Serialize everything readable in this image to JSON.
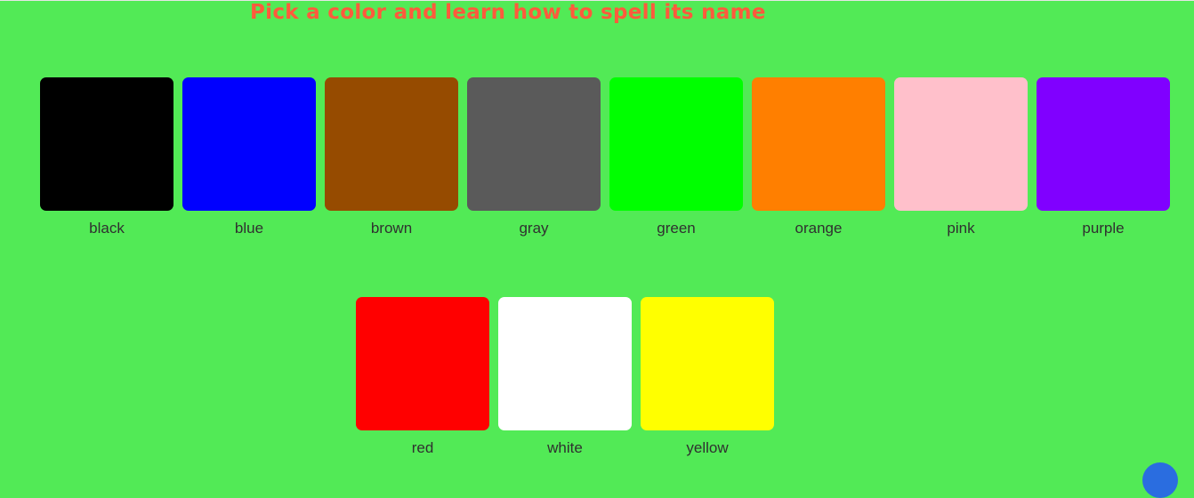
{
  "title": "Pick a color and learn how to spell its name",
  "colors": [
    {
      "name": "black",
      "hex": "#000000"
    },
    {
      "name": "blue",
      "hex": "#0000ff"
    },
    {
      "name": "brown",
      "hex": "#964b00"
    },
    {
      "name": "gray",
      "hex": "#5a5a5a"
    },
    {
      "name": "green",
      "hex": "#00ff00"
    },
    {
      "name": "orange",
      "hex": "#ff7f00"
    },
    {
      "name": "pink",
      "hex": "#ffc0cb"
    },
    {
      "name": "purple",
      "hex": "#8000ff"
    },
    {
      "name": "red",
      "hex": "#ff0000"
    },
    {
      "name": "white",
      "hex": "#ffffff"
    },
    {
      "name": "yellow",
      "hex": "#ffff00"
    }
  ],
  "theme": {
    "background": "#52ea56",
    "title_color": "#ff5a3c",
    "label_color": "#303030"
  }
}
